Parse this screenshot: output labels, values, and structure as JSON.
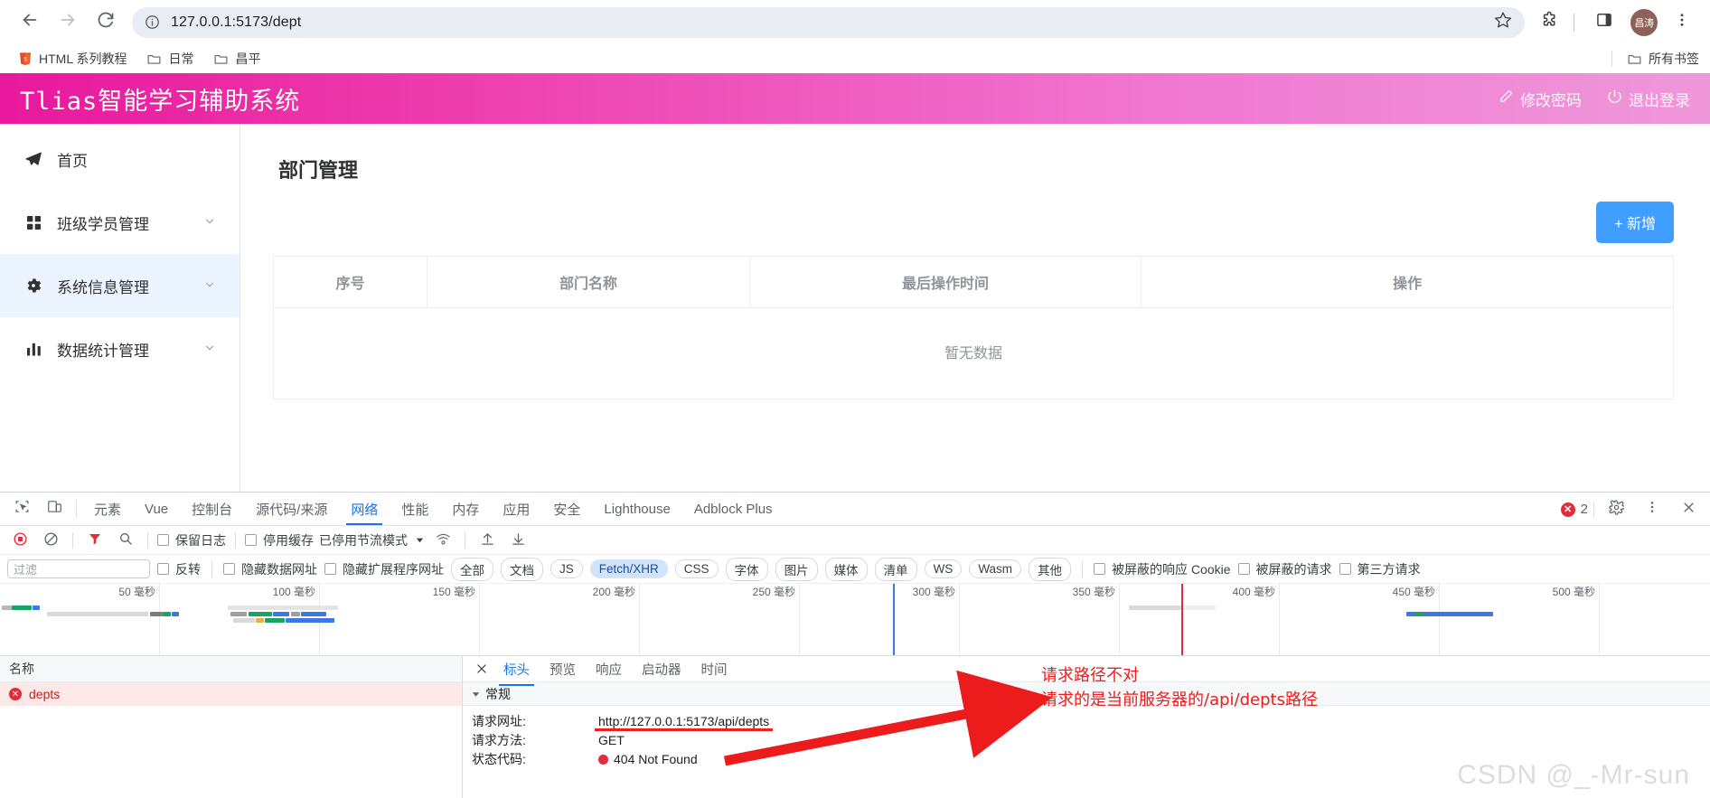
{
  "browser": {
    "back_icon": "back-arrow-icon",
    "forward_icon": "forward-arrow-icon",
    "reload_icon": "reload-icon",
    "url": "127.0.0.1:5173/dept",
    "site_info_icon": "info-circle-icon",
    "bookmark_star_icon": "star-icon",
    "extensions_icon": "extensions-icon",
    "side_panel_icon": "side-panel-icon",
    "avatar_label": "昌涛",
    "menu_icon": "three-dot-menu-icon"
  },
  "bookmarks": {
    "items": [
      {
        "label": "HTML 系列教程",
        "icon": "html5-icon"
      },
      {
        "label": "日常",
        "icon": "folder-icon"
      },
      {
        "label": "昌平",
        "icon": "folder-icon"
      }
    ],
    "all_bookmarks": "所有书签"
  },
  "app": {
    "title": "Tlias智能学习辅助系统",
    "actions": [
      {
        "label": "修改密码",
        "icon": "pencil-icon"
      },
      {
        "label": "退出登录",
        "icon": "power-icon"
      }
    ]
  },
  "sidebar": {
    "items": [
      {
        "label": "首页",
        "icon": "paper-plane-icon",
        "expandable": false,
        "active": false
      },
      {
        "label": "班级学员管理",
        "icon": "grid-icon",
        "expandable": true,
        "active": false
      },
      {
        "label": "系统信息管理",
        "icon": "gear-icon",
        "expandable": true,
        "active": true
      },
      {
        "label": "数据统计管理",
        "icon": "bar-chart-icon",
        "expandable": true,
        "active": false
      }
    ]
  },
  "main": {
    "page_title": "部门管理",
    "add_button": "+ 新增",
    "table": {
      "columns": [
        "序号",
        "部门名称",
        "最后操作时间",
        "操作"
      ],
      "rows": [],
      "empty_text": "暂无数据"
    }
  },
  "devtools": {
    "inspect_icon": "inspect-element-icon",
    "device_icon": "device-toolbar-icon",
    "tabs": [
      {
        "label": "元素",
        "active": false
      },
      {
        "label": "Vue",
        "active": false
      },
      {
        "label": "控制台",
        "active": false
      },
      {
        "label": "源代码/来源",
        "active": false
      },
      {
        "label": "网络",
        "active": true
      },
      {
        "label": "性能",
        "active": false
      },
      {
        "label": "内存",
        "active": false
      },
      {
        "label": "应用",
        "active": false
      },
      {
        "label": "安全",
        "active": false
      },
      {
        "label": "Lighthouse",
        "active": false
      },
      {
        "label": "Adblock Plus",
        "active": false
      }
    ],
    "error_count": "2",
    "settings_icon": "gear-icon",
    "more_icon": "three-dot-menu-icon",
    "close_icon": "close-icon",
    "network_toolbar": {
      "record_icon": "record-stop-icon",
      "clear_icon": "clear-icon",
      "filter_icon": "funnel-icon",
      "search_icon": "search-icon",
      "preserve_log": "保留日志",
      "disable_cache": "停用缓存",
      "throttling": "已停用节流模式",
      "wifi_icon": "network-conditions-icon",
      "import_icon": "import-har-icon",
      "export_icon": "export-har-icon"
    },
    "filter_bar": {
      "filter_placeholder": "过滤",
      "invert": "反转",
      "hide_data_urls": "隐藏数据网址",
      "hide_ext_urls": "隐藏扩展程序网址",
      "type_chips": [
        {
          "label": "全部",
          "active": false
        },
        {
          "label": "文档",
          "active": false
        },
        {
          "label": "JS",
          "active": false
        },
        {
          "label": "Fetch/XHR",
          "active": true
        },
        {
          "label": "CSS",
          "active": false
        },
        {
          "label": "字体",
          "active": false
        },
        {
          "label": "图片",
          "active": false
        },
        {
          "label": "媒体",
          "active": false
        },
        {
          "label": "清单",
          "active": false
        },
        {
          "label": "WS",
          "active": false
        },
        {
          "label": "Wasm",
          "active": false
        },
        {
          "label": "其他",
          "active": false
        }
      ],
      "blocked_cookies": "被屏蔽的响应 Cookie",
      "blocked_requests": "被屏蔽的请求",
      "third_party": "第三方请求"
    },
    "timeline_ticks": [
      "50 毫秒",
      "100 毫秒",
      "150 毫秒",
      "200 毫秒",
      "250 毫秒",
      "300 毫秒",
      "350 毫秒",
      "400 毫秒",
      "450 毫秒",
      "500 毫秒"
    ],
    "request_list": {
      "header": "名称",
      "rows": [
        {
          "name": "depts",
          "status": "error"
        }
      ]
    },
    "detail": {
      "tabs": [
        {
          "label": "标头",
          "active": true
        },
        {
          "label": "预览",
          "active": false
        },
        {
          "label": "响应",
          "active": false
        },
        {
          "label": "启动器",
          "active": false
        },
        {
          "label": "时间",
          "active": false
        }
      ],
      "section_title": "常规",
      "fields": [
        {
          "key": "请求网址:",
          "value": "http://127.0.0.1:5173/api/depts"
        },
        {
          "key": "请求方法:",
          "value": "GET"
        },
        {
          "key": "状态代码:",
          "value": "404 Not Found"
        }
      ]
    }
  },
  "annotation": {
    "line1": "请求路径不对",
    "line2": "请求的是当前服务器的/api/depts路径",
    "color": "#ef1c1c",
    "watermark": "CSDN @_-Mr-sun"
  }
}
